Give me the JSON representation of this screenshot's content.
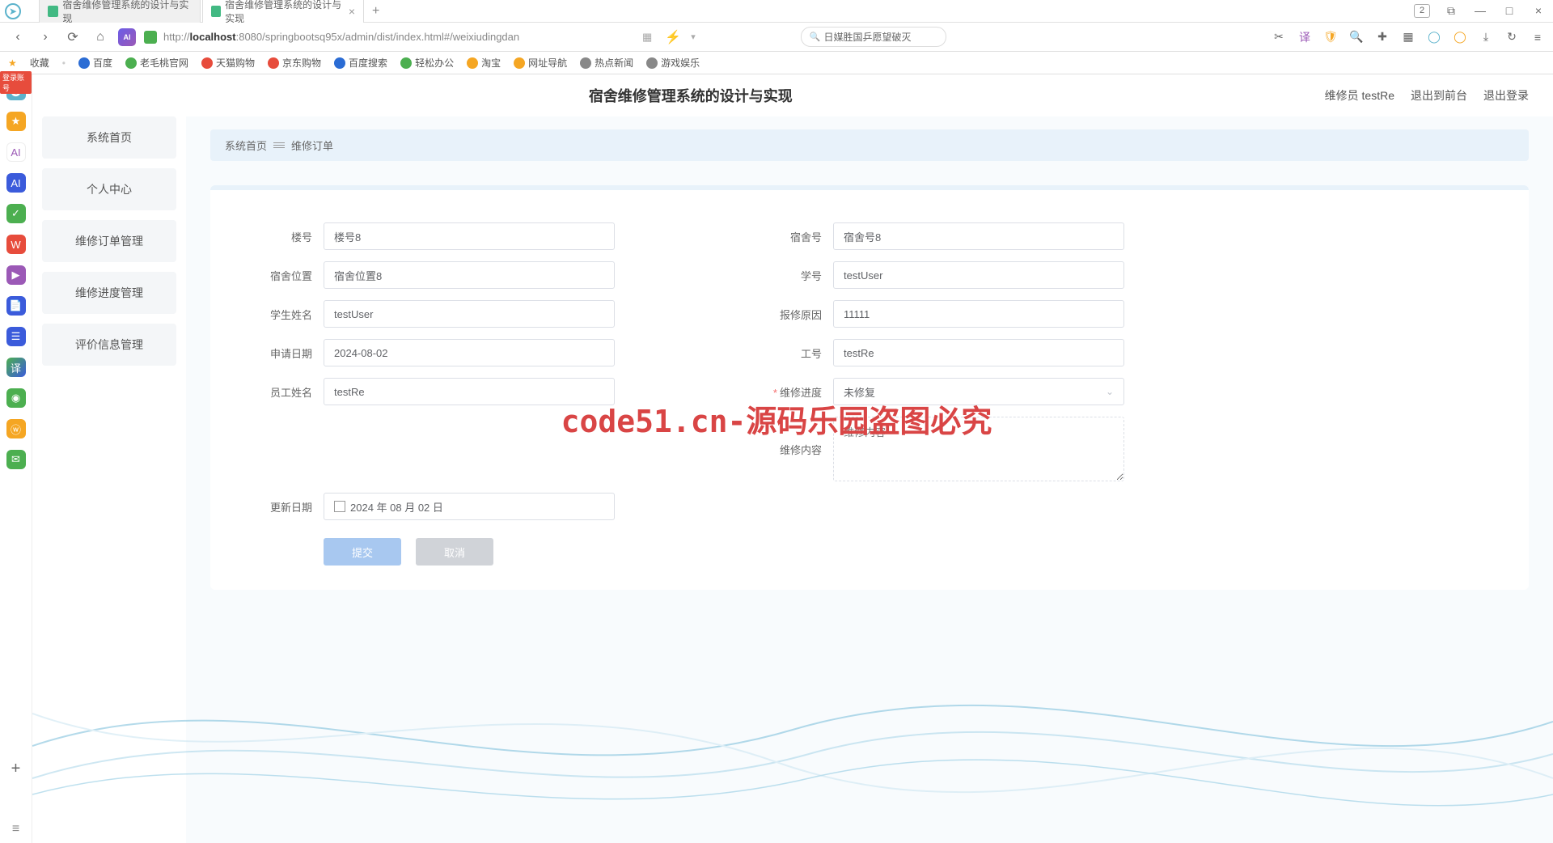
{
  "browser": {
    "tabs": [
      {
        "title": "宿舍维修管理系统的设计与实现",
        "active": false
      },
      {
        "title": "宿舍维修管理系统的设计与实现",
        "active": true
      }
    ],
    "tab_count_badge": "2",
    "url_prefix": "http://",
    "url_host": "localhost",
    "url_rest": ":8080/springbootsq95x/admin/dist/index.html#/weixiudingdan",
    "search_hint": "日媒胜国乒愿望破灭"
  },
  "bookmarks": {
    "favorites": "收藏",
    "items": [
      "百度",
      "老毛桃官网",
      "天猫购物",
      "京东购物",
      "百度搜索",
      "轻松办公",
      "淘宝",
      "网址导航",
      "热点新闻",
      "游戏娱乐"
    ]
  },
  "header": {
    "title": "宿舍维修管理系统的设计与实现",
    "role": "维修员",
    "username": "testRe",
    "logout_front": "退出到前台",
    "logout": "退出登录"
  },
  "sidebar": {
    "items": [
      "系统首页",
      "个人中心",
      "维修订单管理",
      "维修进度管理",
      "评价信息管理"
    ]
  },
  "breadcrumb": {
    "home": "系统首页",
    "current": "维修订单"
  },
  "form": {
    "louhao": {
      "label": "楼号",
      "value": "楼号8"
    },
    "sushehao": {
      "label": "宿舍号",
      "value": "宿舍号8"
    },
    "susheweizhi": {
      "label": "宿舍位置",
      "value": "宿舍位置8"
    },
    "xuehao": {
      "label": "学号",
      "value": "testUser"
    },
    "xueshengxingming": {
      "label": "学生姓名",
      "value": "testUser"
    },
    "baoxiuyuanyin": {
      "label": "报修原因",
      "value": "11111"
    },
    "shenqingriqi": {
      "label": "申请日期",
      "value": "2024-08-02"
    },
    "gonghao": {
      "label": "工号",
      "value": "testRe"
    },
    "yuangongxingming": {
      "label": "员工姓名",
      "value": "testRe"
    },
    "weixiujindu": {
      "label": "维修进度",
      "value": "未修复"
    },
    "weixiuneirong": {
      "label": "维修内容",
      "placeholder": "维修内容"
    },
    "gengxinriqi": {
      "label": "更新日期",
      "value": "2024 年 08 月 02 日"
    }
  },
  "actions": {
    "submit": "提交",
    "cancel": "取消"
  },
  "watermark": "code51.cn-源码乐园盗图必究"
}
